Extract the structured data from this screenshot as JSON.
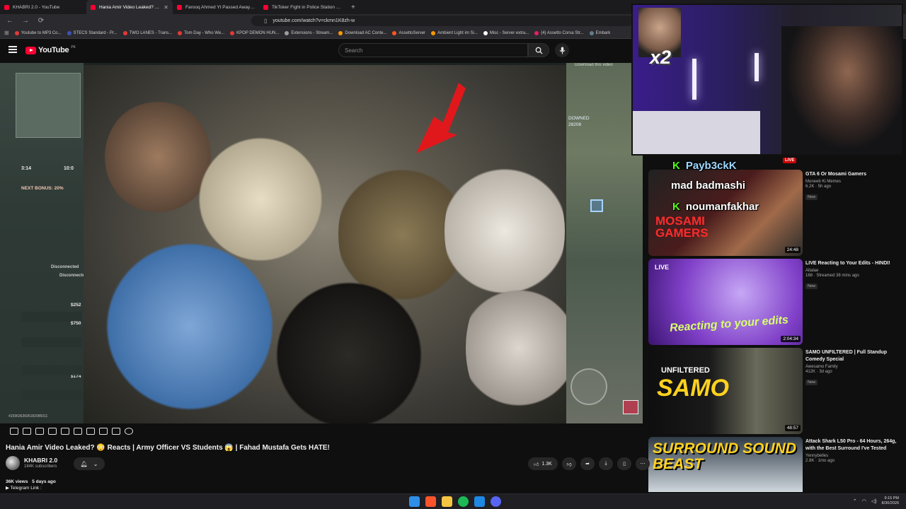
{
  "browser": {
    "tabs": [
      {
        "title": "KHABRI 2.0 - YouTube",
        "active": false
      },
      {
        "title": "Hania Amir Video Leaked? 😳 Reacts",
        "active": true
      },
      {
        "title": "Farooq Ahmed Yt Passed Away 💔 D",
        "active": false
      },
      {
        "title": "TikToker Fight in Police Station 😱 |",
        "active": false
      }
    ],
    "url": "youtube.com/watch?v=ckmn1K8zh-w",
    "bookmarks": [
      "Youtube to MP3 Co...",
      "STECS Standard - Pr...",
      "TWO LANES - Trans...",
      "Tom Day - Who We...",
      "KPOP DEMON HUN...",
      "Extensions - Stream...",
      "Download AC Conte...",
      "AssettoServer",
      "Ambient Light im Si...",
      "Misc - Server extra...",
      "(4) Assetto Corsa Str...",
      "Embark"
    ]
  },
  "youtube": {
    "logo": "YouTube",
    "region": "PK",
    "search_placeholder": "Search"
  },
  "overlay": {
    "x2": "x2",
    "download_text": "Download this video",
    "downed": "DOWNED",
    "downed_id": "28208",
    "hud_timer": "3:14",
    "hud_time2": "10:0",
    "hud_bonus": "NEXT BONUS: 20%",
    "hud_disconnected1": "Disconnected",
    "hud_disconnected2": "Disconnected",
    "hud_money1": "$252",
    "hud_money2": "$750",
    "hud_money3": "$174",
    "hud_id": "41596363695182085011",
    "chat": [
      {
        "badge": "K",
        "user": "Payb3ckK"
      },
      {
        "badge": "",
        "user": "mad badmashi"
      },
      {
        "badge": "K",
        "user": "noumanfakhar"
      }
    ]
  },
  "video": {
    "title": "Hania Amir Video Leaked? 😳 Reacts | Army Officer VS Students 😱 | Fahad Mustafa Gets HATE!",
    "channel": "KHABRI 2.0",
    "subscribers": "184K subscribers",
    "likes": "1.3K",
    "views": "36K views",
    "age": "5 days ago",
    "description_line": "▶ Telegram Link :"
  },
  "recommendations": [
    {
      "title": "GTA 6 Or Mosami Gamers",
      "channel": "Muneeb Ki Memes",
      "meta": "6.2K · 5h ago",
      "badge": "New",
      "duration": "24:48",
      "live": "LIVE",
      "thumb_text": "MOSAMI GAMERS"
    },
    {
      "title": "LIVE Reacting to Your Edits - HINDI!",
      "channel": "Altalae",
      "meta": "168 · Streamed 38 mins ago",
      "badge": "New",
      "duration": "2:04:34",
      "live": "LIVE",
      "thumb_text": "Reacting to your edits"
    },
    {
      "title": "SAMO UNFILTERED | Full Standup Comedy Special",
      "channel": "Awesamo Family",
      "meta": "412K · 3d ago",
      "badge": "New",
      "duration": "48:57",
      "live": "",
      "thumb_text": "SAMO"
    },
    {
      "title": "Attack Shark L50 Pro - 64 Hours, 264g, with the Best Surround I've Tested",
      "channel": "Yennybelles",
      "meta": "2.8K · 1mo ago",
      "badge": "",
      "duration": "",
      "live": "",
      "thumb_text": "SURROUND SOUND BEAST"
    }
  ],
  "taskbar": {
    "time": "9:15 PM",
    "date": "8/30/2026"
  }
}
